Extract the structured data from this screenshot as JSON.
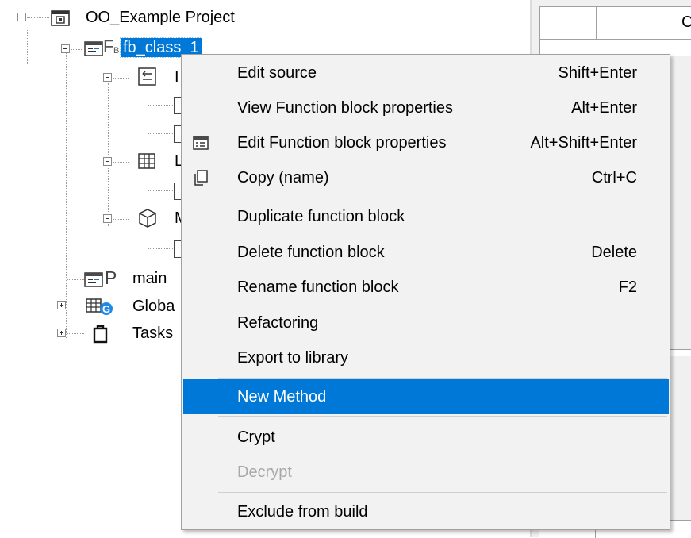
{
  "tree": {
    "project_label": "OO_Example Project",
    "fb_label": "fb_class_1",
    "fb_icon_text": "F",
    "fb_icon_sub": "B",
    "child1_label": "I",
    "child2_label": "L",
    "child3_label": "M",
    "main_label": "main",
    "main_icon_text": "P",
    "globals_label": "Globa",
    "tasks_label": "Tasks"
  },
  "grid": {
    "header_text": "C"
  },
  "menu": {
    "items": [
      {
        "label": "Edit source",
        "shortcut": "Shift+Enter"
      },
      {
        "label": "View Function block properties",
        "shortcut": "Alt+Enter"
      },
      {
        "label": "Edit Function block properties",
        "shortcut": "Alt+Shift+Enter",
        "icon": "properties-icon"
      },
      {
        "label": "Copy (name)",
        "shortcut": "Ctrl+C",
        "icon": "copy-icon"
      },
      {
        "label": "Duplicate function block",
        "shortcut": ""
      },
      {
        "label": "Delete function block",
        "shortcut": "Delete"
      },
      {
        "label": "Rename function block",
        "shortcut": "F2"
      },
      {
        "label": "Refactoring",
        "shortcut": ""
      },
      {
        "label": "Export to library",
        "shortcut": ""
      },
      {
        "label": "New Method",
        "shortcut": "",
        "highlighted": true
      },
      {
        "label": "Crypt",
        "shortcut": ""
      },
      {
        "label": "Decrypt",
        "shortcut": "",
        "disabled": true
      },
      {
        "label": "Exclude from build",
        "shortcut": ""
      }
    ]
  },
  "colors": {
    "selection": "#0078d7",
    "menu_background": "#f2f2f2",
    "disabled_text": "#a8a8a8",
    "globals_badge": "#1e88e5"
  }
}
